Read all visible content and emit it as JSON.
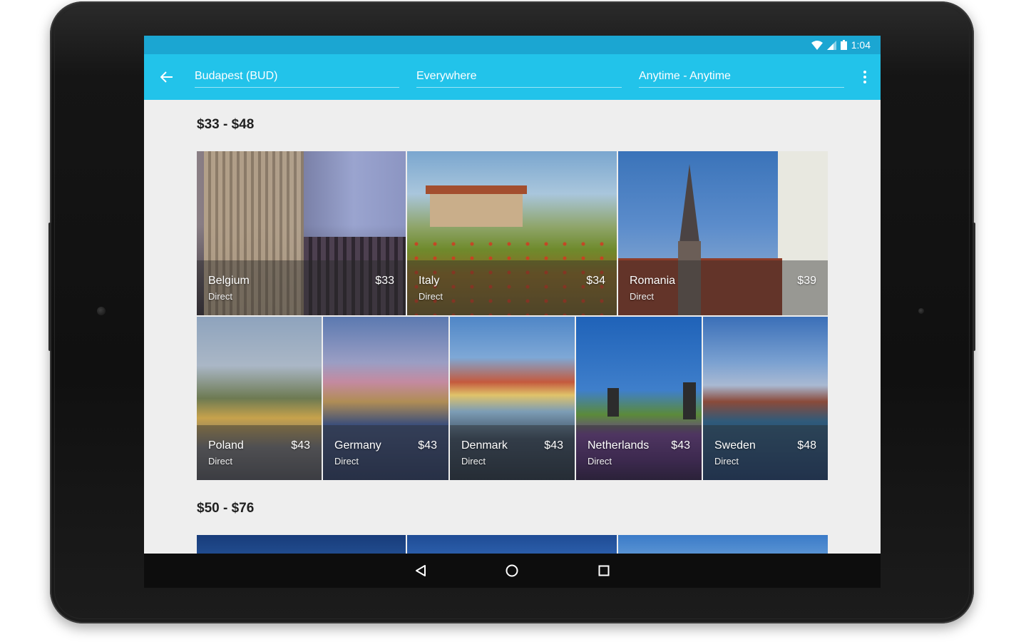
{
  "status_bar": {
    "time": "1:04"
  },
  "search": {
    "origin": "Budapest (BUD)",
    "destination": "Everywhere",
    "dates": "Anytime - Anytime"
  },
  "sections": [
    {
      "title": "$33 - $48",
      "destinations": [
        {
          "name": "Belgium",
          "type": "Direct",
          "price": "$33"
        },
        {
          "name": "Italy",
          "type": "Direct",
          "price": "$34"
        },
        {
          "name": "Romania",
          "type": "Direct",
          "price": "$39"
        },
        {
          "name": "Poland",
          "type": "Direct",
          "price": "$43"
        },
        {
          "name": "Germany",
          "type": "Direct",
          "price": "$43"
        },
        {
          "name": "Denmark",
          "type": "Direct",
          "price": "$43"
        },
        {
          "name": "Netherlands",
          "type": "Direct",
          "price": "$43"
        },
        {
          "name": "Sweden",
          "type": "Direct",
          "price": "$48"
        }
      ]
    },
    {
      "title": "$50 - $76"
    }
  ],
  "colors": {
    "status_bar": "#1ba6d2",
    "app_bar": "#22c3ea",
    "background": "#eeeeee",
    "navigation_bar": "#0d0d0d"
  },
  "icons": {
    "back": "arrow-left-icon",
    "overflow": "more-vertical-icon",
    "wifi": "wifi-icon",
    "signal": "signal-icon",
    "battery": "battery-icon",
    "nav_back": "triangle-back-icon",
    "nav_home": "circle-home-icon",
    "nav_recents": "square-recents-icon"
  }
}
